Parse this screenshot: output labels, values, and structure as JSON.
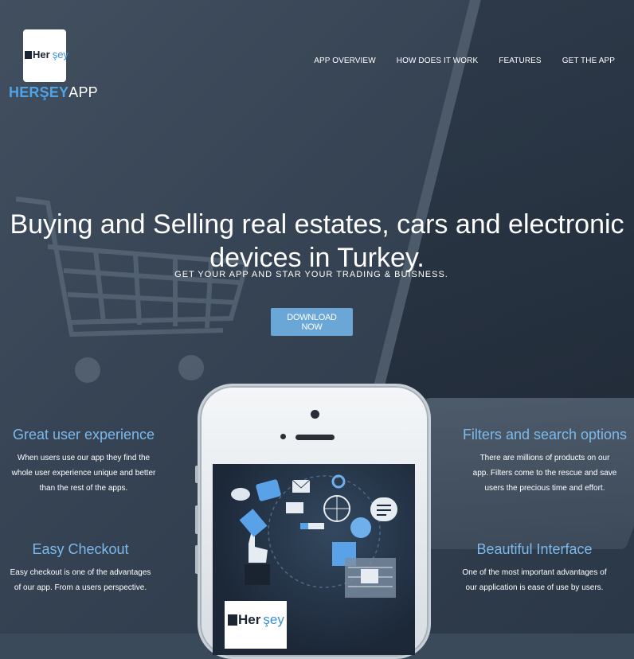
{
  "brand": {
    "logo_text_main": "Her",
    "logo_text_accent": "şey",
    "name_part1": "HERŞEY",
    "name_part2": "APP",
    "accent_color": "#4fa3e6"
  },
  "nav": {
    "items": [
      "APP OVERVIEW",
      "HOW DOES IT WORK",
      "FEATURES",
      "GET THE APP"
    ]
  },
  "hero": {
    "title_line1": "Buying and Selling real estates, cars and electronic",
    "title_line2": "devices in Turkey.",
    "subtitle": "GET YOUR APP AND STAR YOUR TRADING & BUISNESS.",
    "cta_label": "DOWNLOAD NOW",
    "cta_color": "#6aa6d6"
  },
  "features": [
    {
      "title": "Great user experience",
      "lines": [
        "When users use our app they find the",
        "whole user experience unique and better",
        "than the rest of the apps."
      ]
    },
    {
      "title": "Filters and search options",
      "lines": [
        "There are millions of products on our",
        "app. Filters come to the rescue and save",
        "users the precious time and effort."
      ]
    },
    {
      "title": "Easy Checkout",
      "lines": [
        "Easy checkout is one of the advantages",
        "of our app. From a users perspective."
      ]
    },
    {
      "title": "Beautiful Interface",
      "lines": [
        "One of the most important advantages of",
        "our application is ease of use by users."
      ]
    }
  ],
  "phone_screen": {
    "logo_text_main": "Her",
    "logo_text_accent": "şey"
  }
}
